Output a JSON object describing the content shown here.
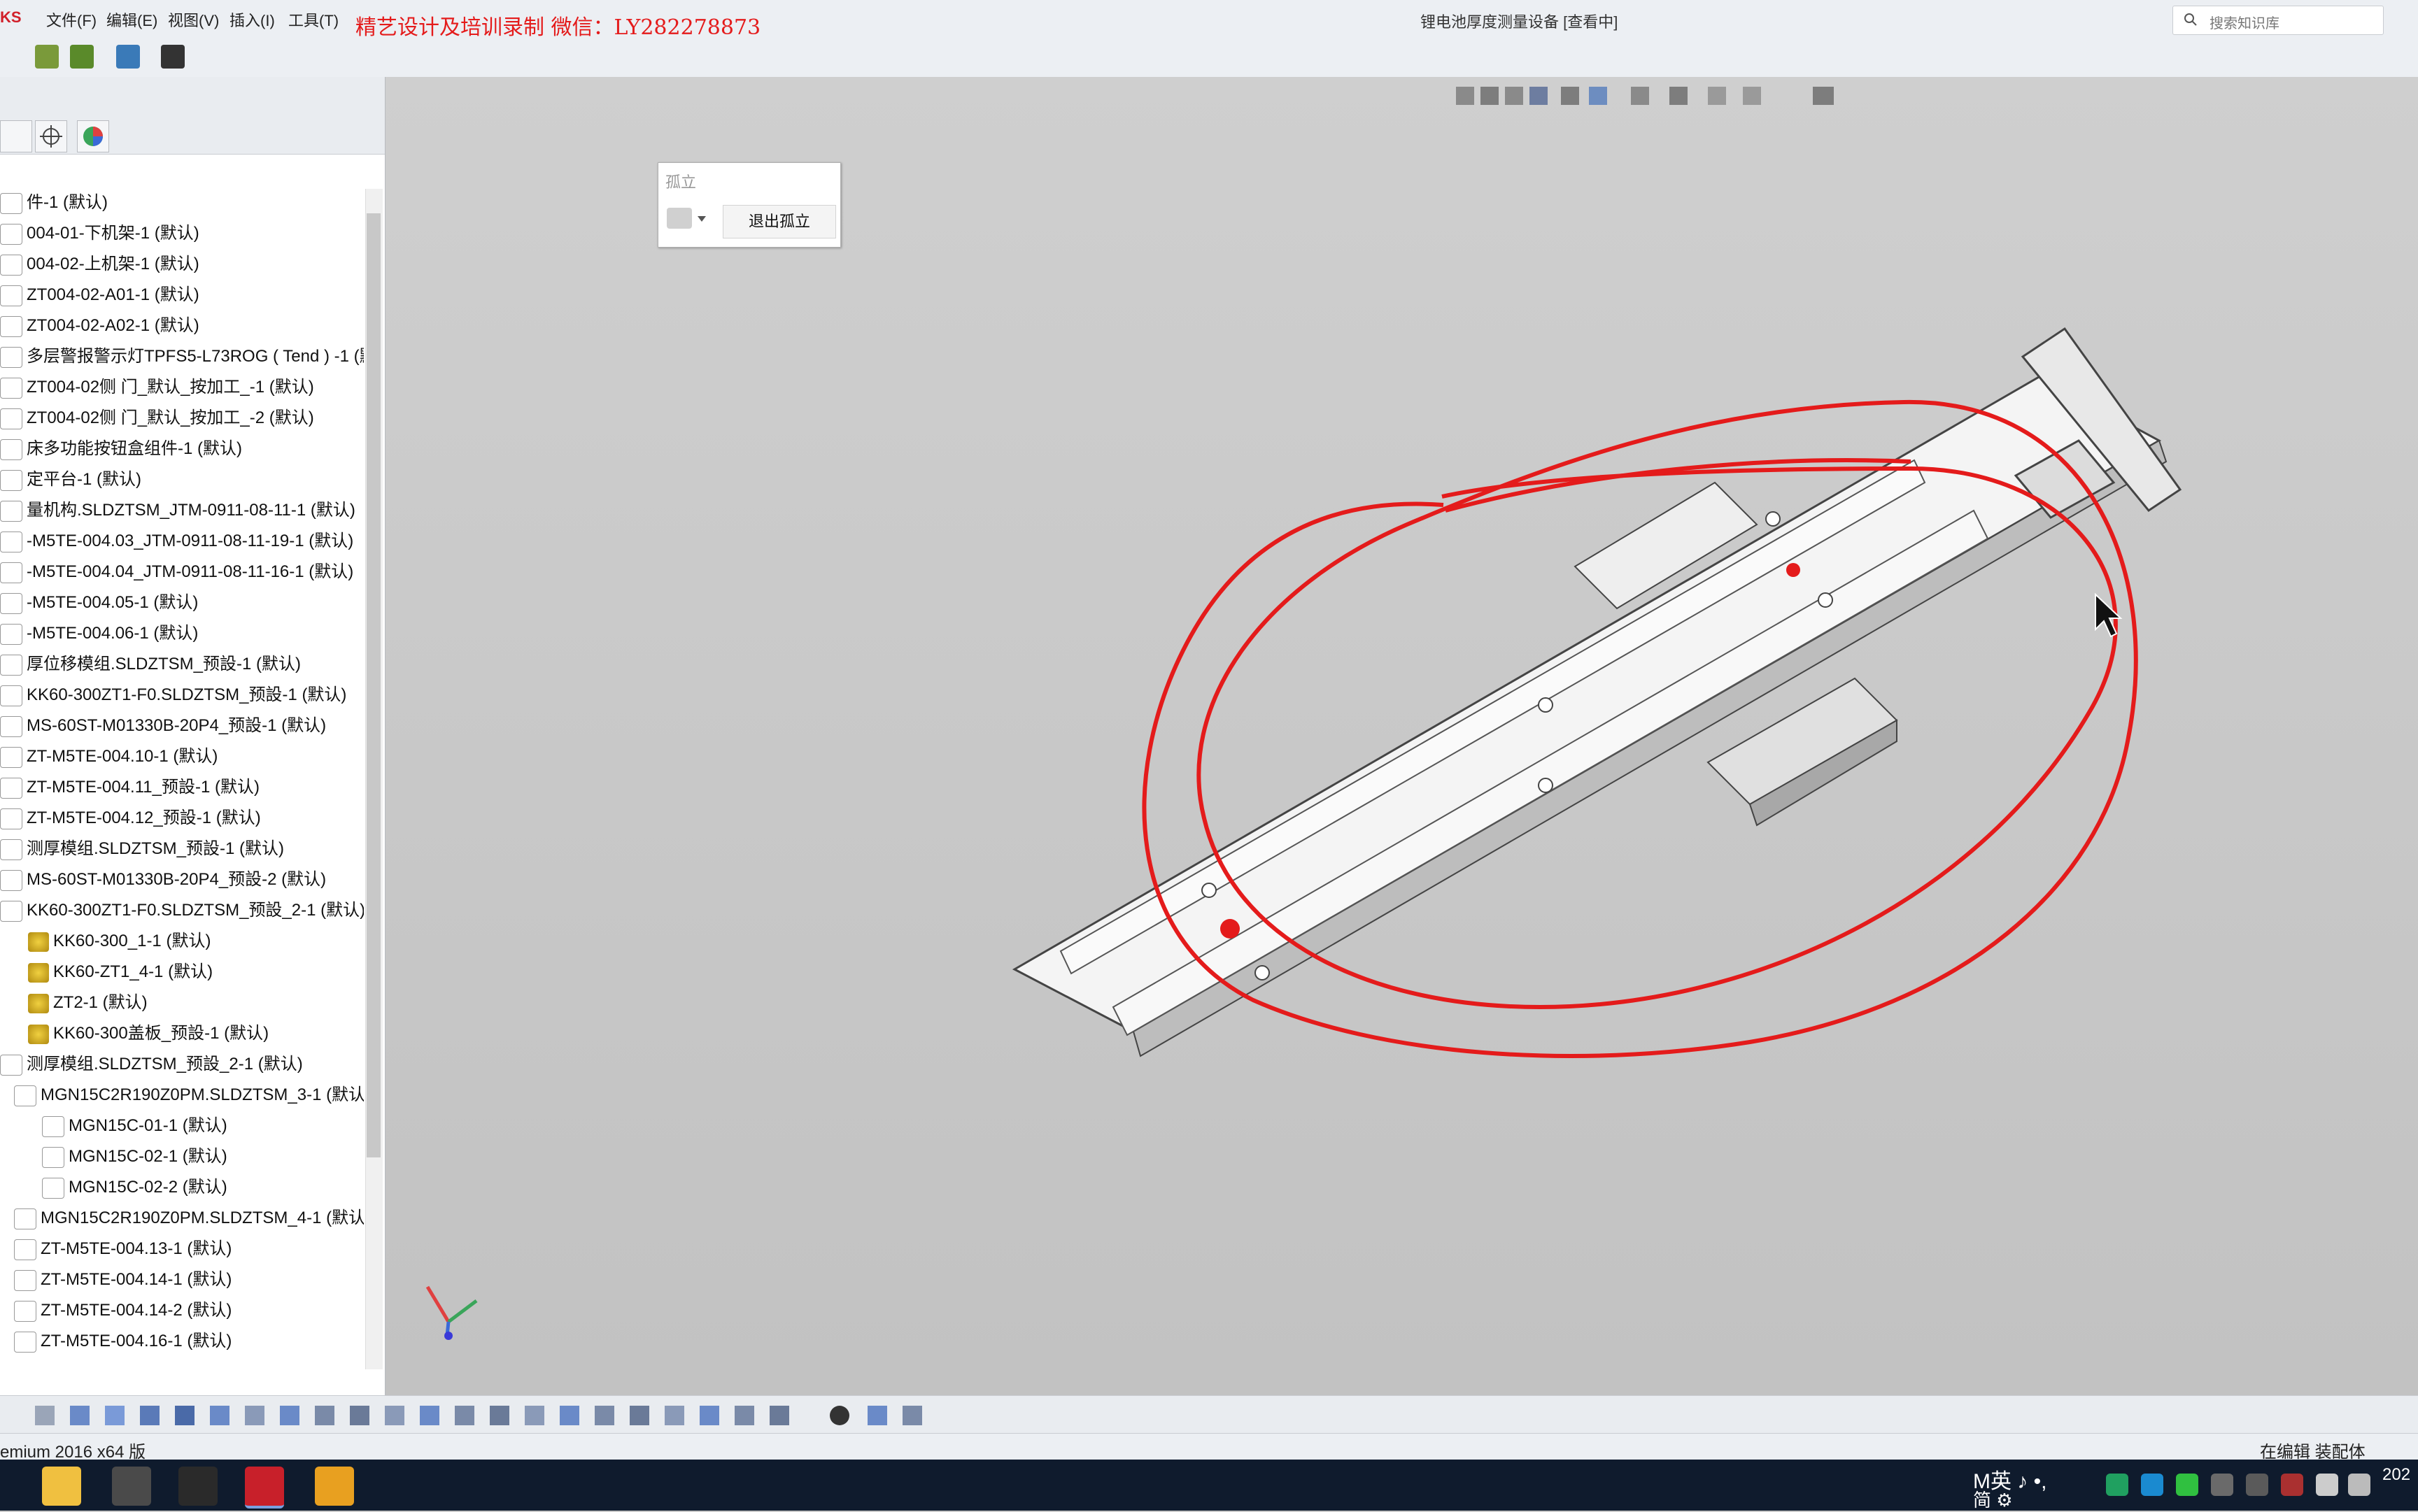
{
  "app": {
    "brand": "KS",
    "document_title": "锂电池厚度测量设备 [查看中]",
    "watermark_small": "精艺设计及培训录制 微信：LY282278873",
    "watermark_big": "精艺设计及培训录制 微信：LY282278873"
  },
  "menu": {
    "items": [
      "文件(F)",
      "编辑(E)",
      "视图(V)",
      "插入(I)",
      "工具(T)"
    ]
  },
  "search": {
    "placeholder": "搜索知识库"
  },
  "isolate": {
    "title": "孤立",
    "exit_label": "退出孤立"
  },
  "tree": {
    "items": [
      "件-1 (默认)",
      "004-01-下机架-1 (默认)",
      "004-02-上机架-1 (默认)",
      "ZT004-02-A01-1 (默认)",
      "ZT004-02-A02-1 (默认)",
      "多层警报警示灯TPFS5-L73ROG ( Tend ) -1 (默",
      "ZT004-02侧 门_默认_按加工_-1 (默认)",
      "ZT004-02侧 门_默认_按加工_-2 (默认)",
      "床多功能按钮盒组件-1 (默认)",
      "定平台-1 (默认)",
      "量机构.SLDZTSM_JTM-0911-08-11-1 (默认)",
      "-M5TE-004.03_JTM-0911-08-11-19-1 (默认)",
      "-M5TE-004.04_JTM-0911-08-11-16-1 (默认)",
      "-M5TE-004.05-1 (默认)",
      "-M5TE-004.06-1 (默认)",
      "厚位移模组.SLDZTSM_预設-1 (默认)",
      "KK60-300ZT1-F0.SLDZTSM_预設-1 (默认)",
      "MS-60ST-M01330B-20P4_预設-1 (默认)",
      "ZT-M5TE-004.10-1 (默认)",
      "ZT-M5TE-004.11_预設-1 (默认)",
      "ZT-M5TE-004.12_预設-1 (默认)",
      "测厚模组.SLDZTSM_预設-1 (默认)",
      "MS-60ST-M01330B-20P4_预設-2 (默认)",
      "KK60-300ZT1-F0.SLDZTSM_预設_2-1 (默认)",
      "KK60-300_1-1 (默认)",
      "KK60-ZT1_4-1 (默认)",
      "ZT2-1 (默认)",
      "KK60-300盖板_预設-1 (默认)",
      "测厚模组.SLDZTSM_预設_2-1 (默认)",
      "MGN15C2R190Z0PM.SLDZTSM_3-1 (默认",
      "MGN15C-01-1 (默认)",
      "MGN15C-02-1 (默认)",
      "MGN15C-02-2 (默认)",
      "MGN15C2R190Z0PM.SLDZTSM_4-1 (默认",
      "ZT-M5TE-004.13-1 (默认)",
      "ZT-M5TE-004.14-1 (默认)",
      "ZT-M5TE-004.14-2 (默认)",
      "ZT-M5TE-004.16-1 (默认)"
    ]
  },
  "status": {
    "left": "emium 2016 x64 版",
    "right": "在编辑 装配体"
  },
  "tray": {
    "line1": "M英 ♪ •,",
    "line2": "简 ⚙",
    "clock": "202"
  },
  "colors": {
    "annotation": "#e41b1b",
    "taskbar": "#0f1b2d"
  }
}
